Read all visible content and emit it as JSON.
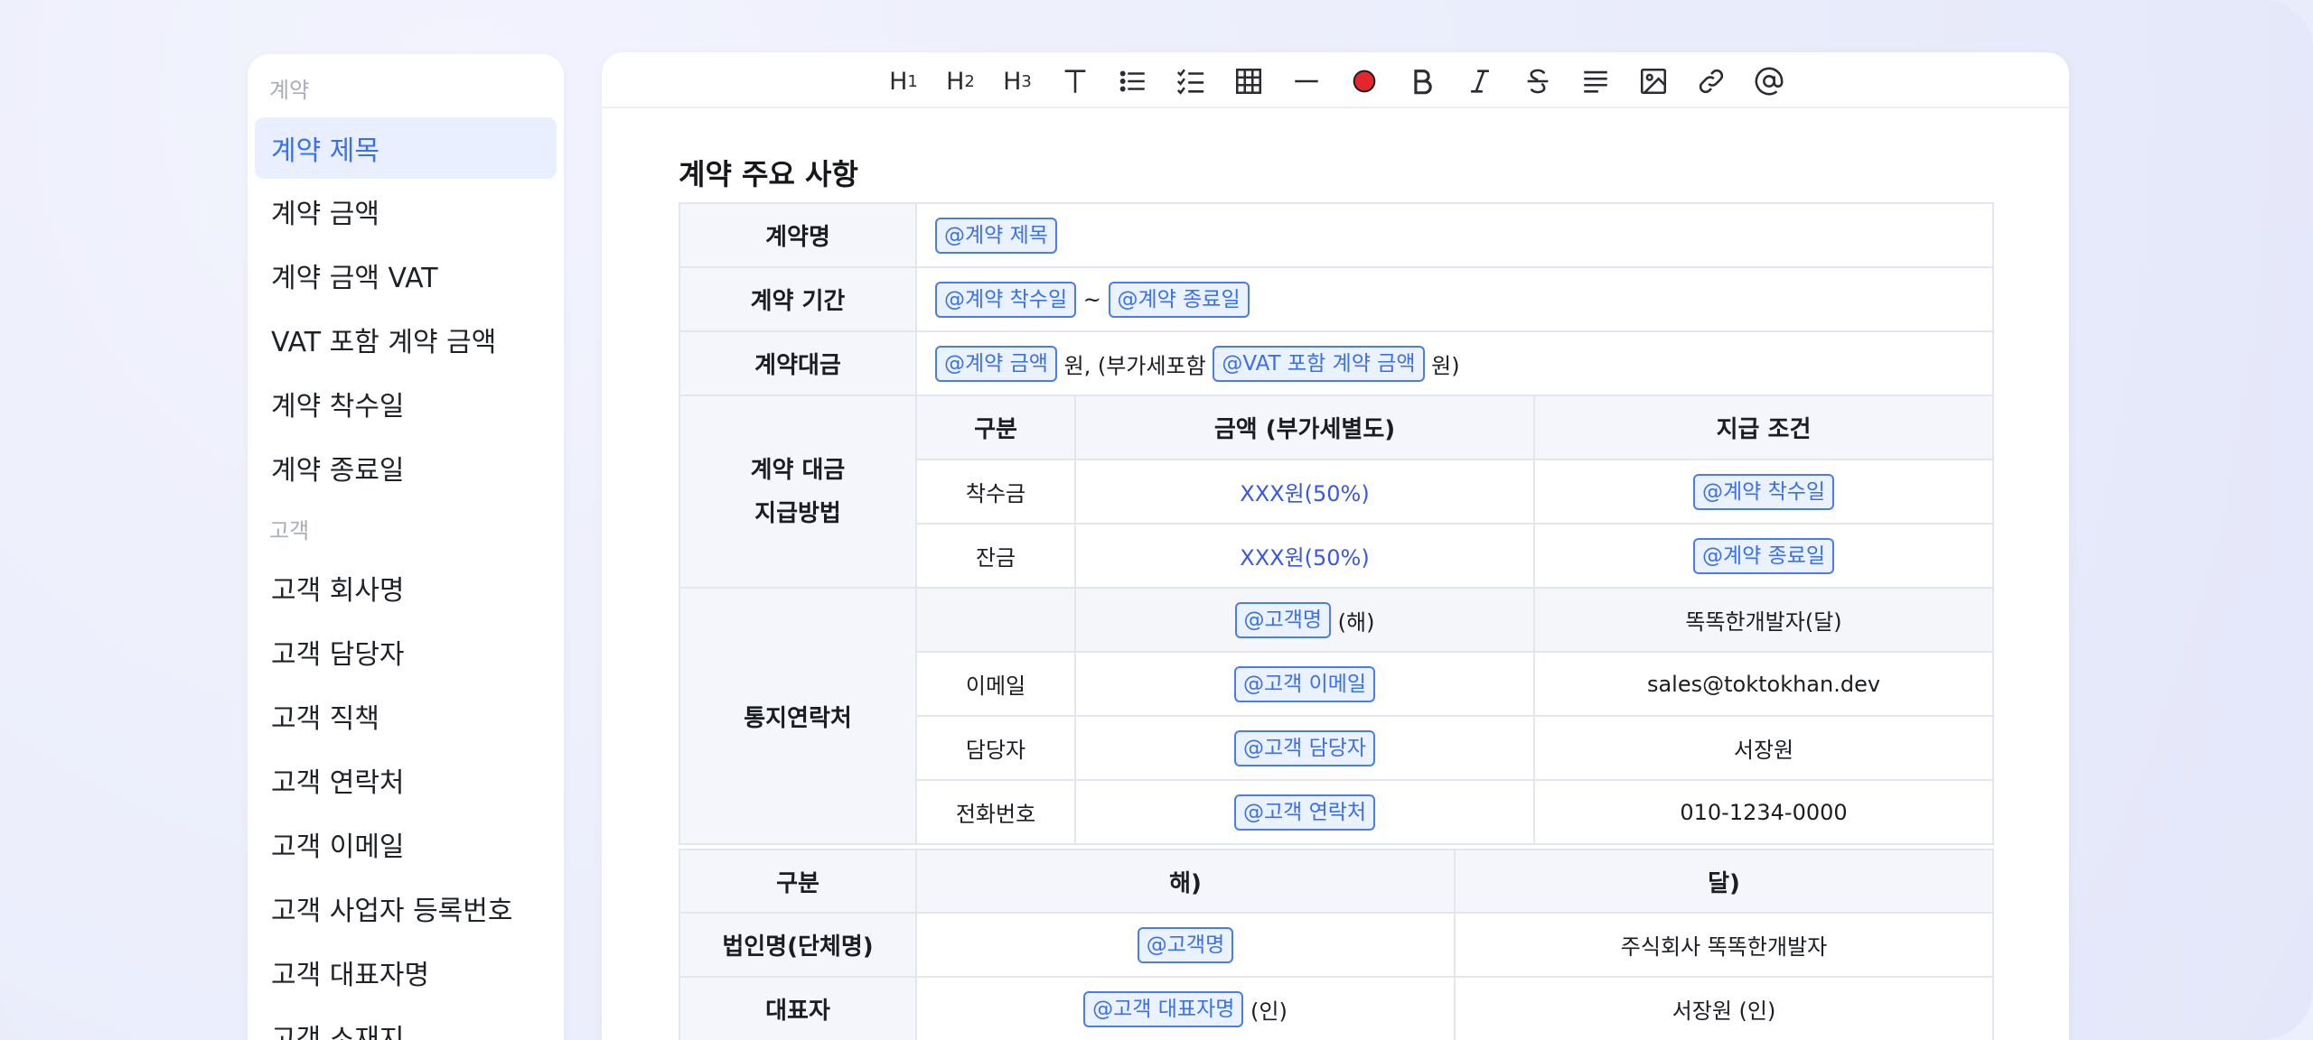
{
  "sidebar": {
    "groups": {
      "contract": "계약",
      "customer": "고객"
    },
    "items": [
      {
        "label": "계약 제목"
      },
      {
        "label": "계약 금액"
      },
      {
        "label": "계약 금액 VAT"
      },
      {
        "label": "VAT 포함 계약 금액"
      },
      {
        "label": "계약 착수일"
      },
      {
        "label": "계약 종료일"
      },
      {
        "label": "고객 회사명"
      },
      {
        "label": "고객 담당자"
      },
      {
        "label": "고객 직책"
      },
      {
        "label": "고객 연락처"
      },
      {
        "label": "고객 이메일"
      },
      {
        "label": "고객 사업자 등록번호"
      },
      {
        "label": "고객 대표자명"
      },
      {
        "label": "고객 소재지"
      }
    ]
  },
  "toolbar": {
    "h1": "H",
    "h1_sub": "1",
    "h2": "H",
    "h2_sub": "2",
    "h3": "H",
    "h3_sub": "3",
    "color_dot": "#e5262c",
    "icons": [
      "text-icon",
      "bullet-list-icon",
      "checklist-icon",
      "table-icon",
      "divider-icon",
      "color-icon",
      "bold-icon",
      "italic-icon",
      "strikethrough-icon",
      "align-left-icon",
      "image-icon",
      "link-icon",
      "mention-icon"
    ]
  },
  "doc": {
    "title": "계약 주요 사항",
    "row_name": {
      "label": "계약명",
      "chip": "@계약 제목"
    },
    "row_period": {
      "label": "계약 기간",
      "chip_start": "@계약 착수일",
      "sep": "~",
      "chip_end": "@계약 종료일"
    },
    "row_price": {
      "label": "계약대금",
      "chip_amount": "@계약 금액",
      "text1": "원, (부가세포함",
      "chip_vat": "@VAT 포함 계약 금액",
      "text2": "원)"
    },
    "payment": {
      "label_line1": "계약 대금",
      "label_line2": "지급방법",
      "headers": [
        "구분",
        "금액 (부가세별도)",
        "지급 조건"
      ],
      "rows": [
        {
          "type": "착수금",
          "amount": "XXX원(50%)",
          "chip": "@계약 착수일"
        },
        {
          "type": "잔금",
          "amount": "XXX원(50%)",
          "chip": "@계약 종료일"
        }
      ]
    },
    "contact": {
      "label": "통지연락처",
      "header_chip": "@고객명",
      "header_suffix": "(해)",
      "header_right": "똑똑한개발자(달)",
      "rows": [
        {
          "label": "이메일",
          "chip": "@고객 이메일",
          "value": "sales@toktokhan.dev"
        },
        {
          "label": "담당자",
          "chip": "@고객 담당자",
          "value": "서장원"
        },
        {
          "label": "전화번호",
          "chip": "@고객 연락처",
          "value": "010-1234-0000"
        }
      ]
    },
    "sign": {
      "headers": [
        "구분",
        "해)",
        "달)"
      ],
      "rows": [
        {
          "label": "법인명(단체명)",
          "chip": "@고객명",
          "suffix": "",
          "value": "주식회사 똑똑한개발자"
        },
        {
          "label": "대표자",
          "chip": "@고객 대표자명",
          "suffix": "(인)",
          "value": "서장원 (인)"
        }
      ]
    }
  }
}
